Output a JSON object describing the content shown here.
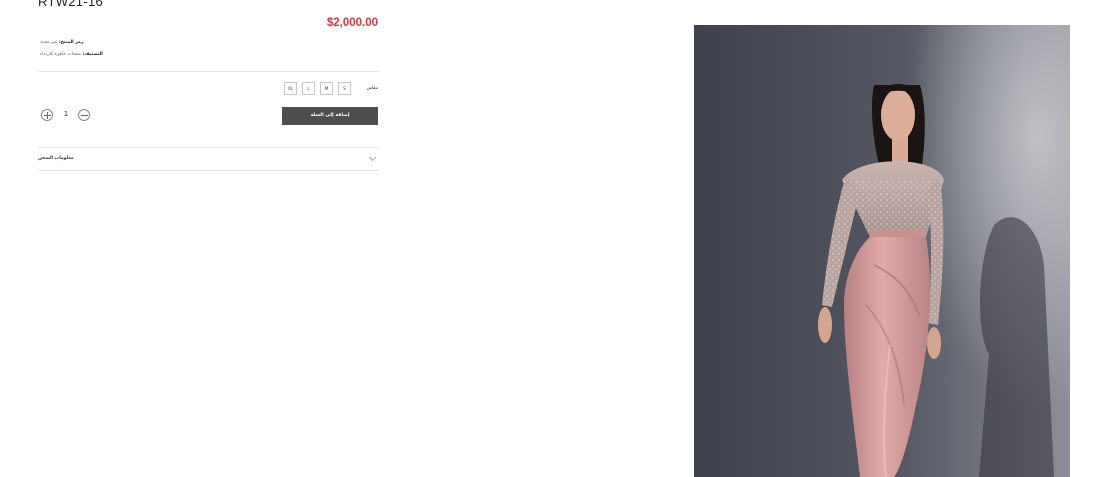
{
  "product": {
    "title": "RTW21-16",
    "price": "$2,000.00",
    "sku_label": "رمز المنتج:",
    "sku_value": "غير محدد",
    "category_label": "التصنيف:",
    "category_value": "منتجات جاهزة للارتداء"
  },
  "sizes": {
    "label": "مقاس",
    "options": [
      "XL",
      "L",
      "M",
      "S"
    ]
  },
  "quantity": {
    "value": "1"
  },
  "cart": {
    "add_label": "إضافة إلى السلة"
  },
  "accordion": {
    "shipping_label": "معلومات الشحن"
  },
  "colors": {
    "price": "#d9363e",
    "button": "#4e4e4e",
    "dress_skirt": "#d39a9b",
    "photo_background": "#4a4c57"
  }
}
